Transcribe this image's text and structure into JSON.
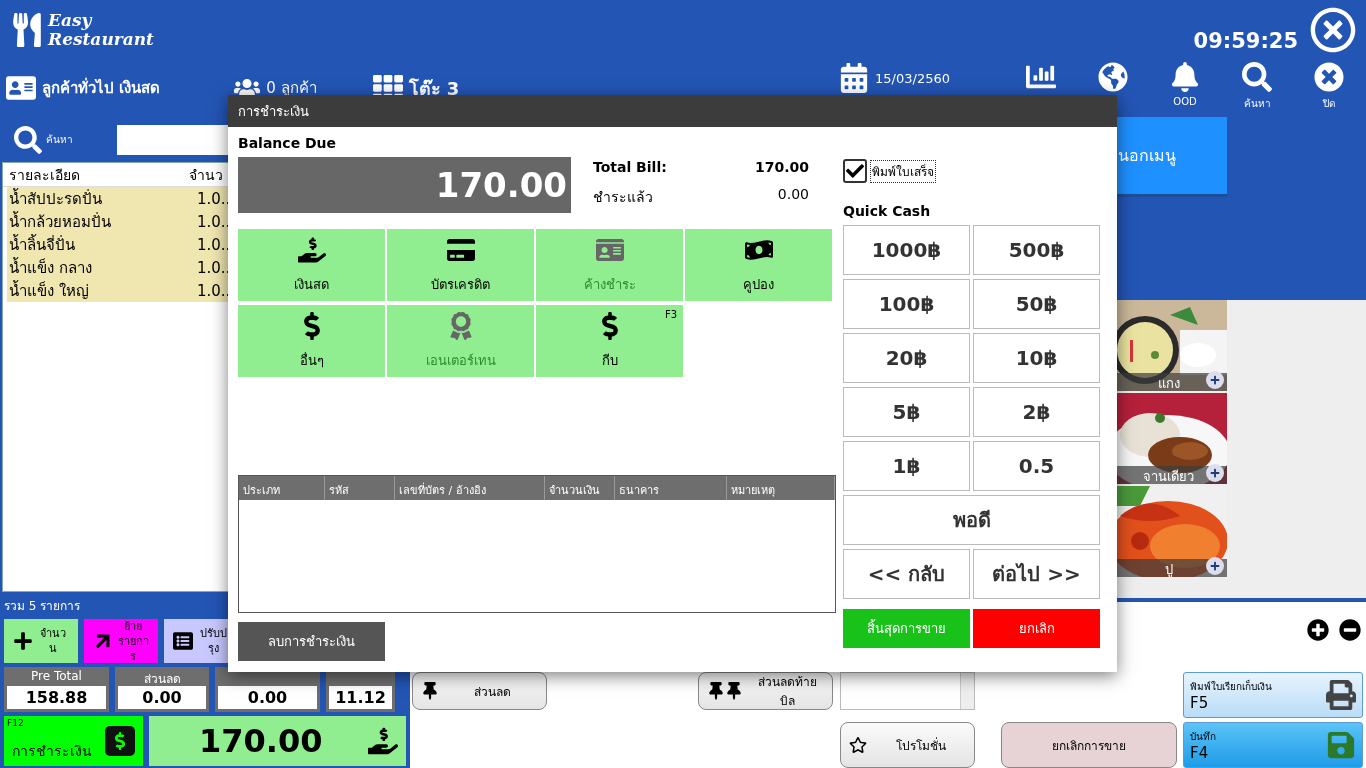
{
  "app": {
    "logo_top": "Easy",
    "logo_bottom": "Restaurant",
    "time": "09:59:25"
  },
  "toolbar": {
    "customer": "ลูกค้าทั่วไป เงินสด",
    "guests": "0 ลูกค้า",
    "table": "โต๊ะ 3",
    "date": "15/03/2560",
    "tools": [
      {
        "kind": "chart"
      },
      {
        "kind": "globe"
      },
      {
        "kind": "bell",
        "label": "OOD"
      },
      {
        "kind": "search",
        "label": "ค้นหา"
      },
      {
        "kind": "close",
        "label": "ปิด"
      }
    ]
  },
  "search": {
    "label": "ค้นหา"
  },
  "order": {
    "columns": [
      "รายละเอียด",
      "จำนว"
    ],
    "rows": [
      {
        "name": "น้ำสัปปะรดปั่น",
        "qty": "1.0.."
      },
      {
        "name": "น้ำกล้วยหอมปั่น",
        "qty": "1.0.."
      },
      {
        "name": "น้ำลิ้นจี่ปั่น",
        "qty": "1.0.."
      },
      {
        "name": "น้ำแข็ง กลาง",
        "qty": "1.0.."
      },
      {
        "name": "น้ำแข็ง ใหญ่",
        "qty": "1.0.."
      }
    ],
    "summary": "รวม 5 รายการ"
  },
  "actions": [
    {
      "kind": "quantity",
      "label": "จำนวน"
    },
    {
      "kind": "move",
      "label": "ย้ายรายการ"
    },
    {
      "kind": "adjust",
      "label": "ปรับปรุง"
    }
  ],
  "totals": [
    {
      "label": "Pre Total",
      "value": "158.88"
    },
    {
      "label": "ส่วนลด",
      "value": "0.00"
    },
    {
      "value": "0.00"
    },
    {
      "value": "11.12"
    }
  ],
  "pay_button": {
    "hint": "F12",
    "label": "การชำระเงิน"
  },
  "grand_total": "170.00",
  "bottom_buttons": [
    {
      "kind": "discount",
      "label": "ส่วนลด"
    },
    {
      "kind": "bill_discount",
      "label": "ส่วนลดท้ายบิล"
    },
    {
      "kind": "promotion",
      "label": "โปรโมชั่น"
    },
    {
      "kind": "cancel_sale",
      "label": "ยกเลิกการขาย"
    }
  ],
  "menu": {
    "category": "นอกเมนู",
    "items": [
      {
        "name": "แกง"
      },
      {
        "name": "จานเดียว"
      },
      {
        "name": "ปู"
      }
    ]
  },
  "print_bill": {
    "label": "พิมพ์ใบเรียกเก็บเงิน",
    "key": "F5"
  },
  "save": {
    "label": "บันทึก",
    "key": "F4"
  },
  "dialog": {
    "title": "การชำระเงิน",
    "balance_label": "Balance Due",
    "balance": "170.00",
    "summary": [
      {
        "label": "Total Bill:",
        "value": "170.00",
        "kind": "total"
      },
      {
        "label": "ชำระแล้ว",
        "value": "0.00",
        "kind": "paid"
      }
    ],
    "methods": [
      {
        "kind": "cash",
        "label": "เงินสด",
        "disabled": false
      },
      {
        "kind": "card",
        "label": "บัตรเครดิต",
        "disabled": false
      },
      {
        "kind": "credit",
        "label": "ค้างชำระ",
        "disabled": true
      },
      {
        "kind": "coupon",
        "label": "คูปอง",
        "disabled": false
      },
      {
        "kind": "dollar",
        "label": "อื่นๆ",
        "disabled": false
      },
      {
        "kind": "award",
        "label": "เอนเตอร์เทน",
        "disabled": true
      },
      {
        "kind": "dollar",
        "label": "กีบ",
        "disabled": false,
        "hint": "F3"
      }
    ],
    "columns": [
      "ประเภท",
      "รหัส",
      "เลขที่บัตร / อ้างอิง",
      "จำนวนเงิน",
      "ธนาคาร",
      "หมายเหตุ"
    ],
    "delete_button": "ลบการชำระเงิน",
    "print_receipt": {
      "label": "พิมพ์ใบเสร็จ",
      "checked": true
    },
    "quick_cash_label": "Quick Cash",
    "quick_cash": [
      "1000฿",
      "500฿",
      "100฿",
      "50฿",
      "20฿",
      "10฿",
      "5฿",
      "2฿",
      "1฿",
      "0.5"
    ],
    "exact": "พอดี",
    "back": "<< กลับ",
    "next": "ต่อไป >>",
    "finish": "สิ้นสุดการขาย",
    "cancel": "ยกเลิก"
  }
}
